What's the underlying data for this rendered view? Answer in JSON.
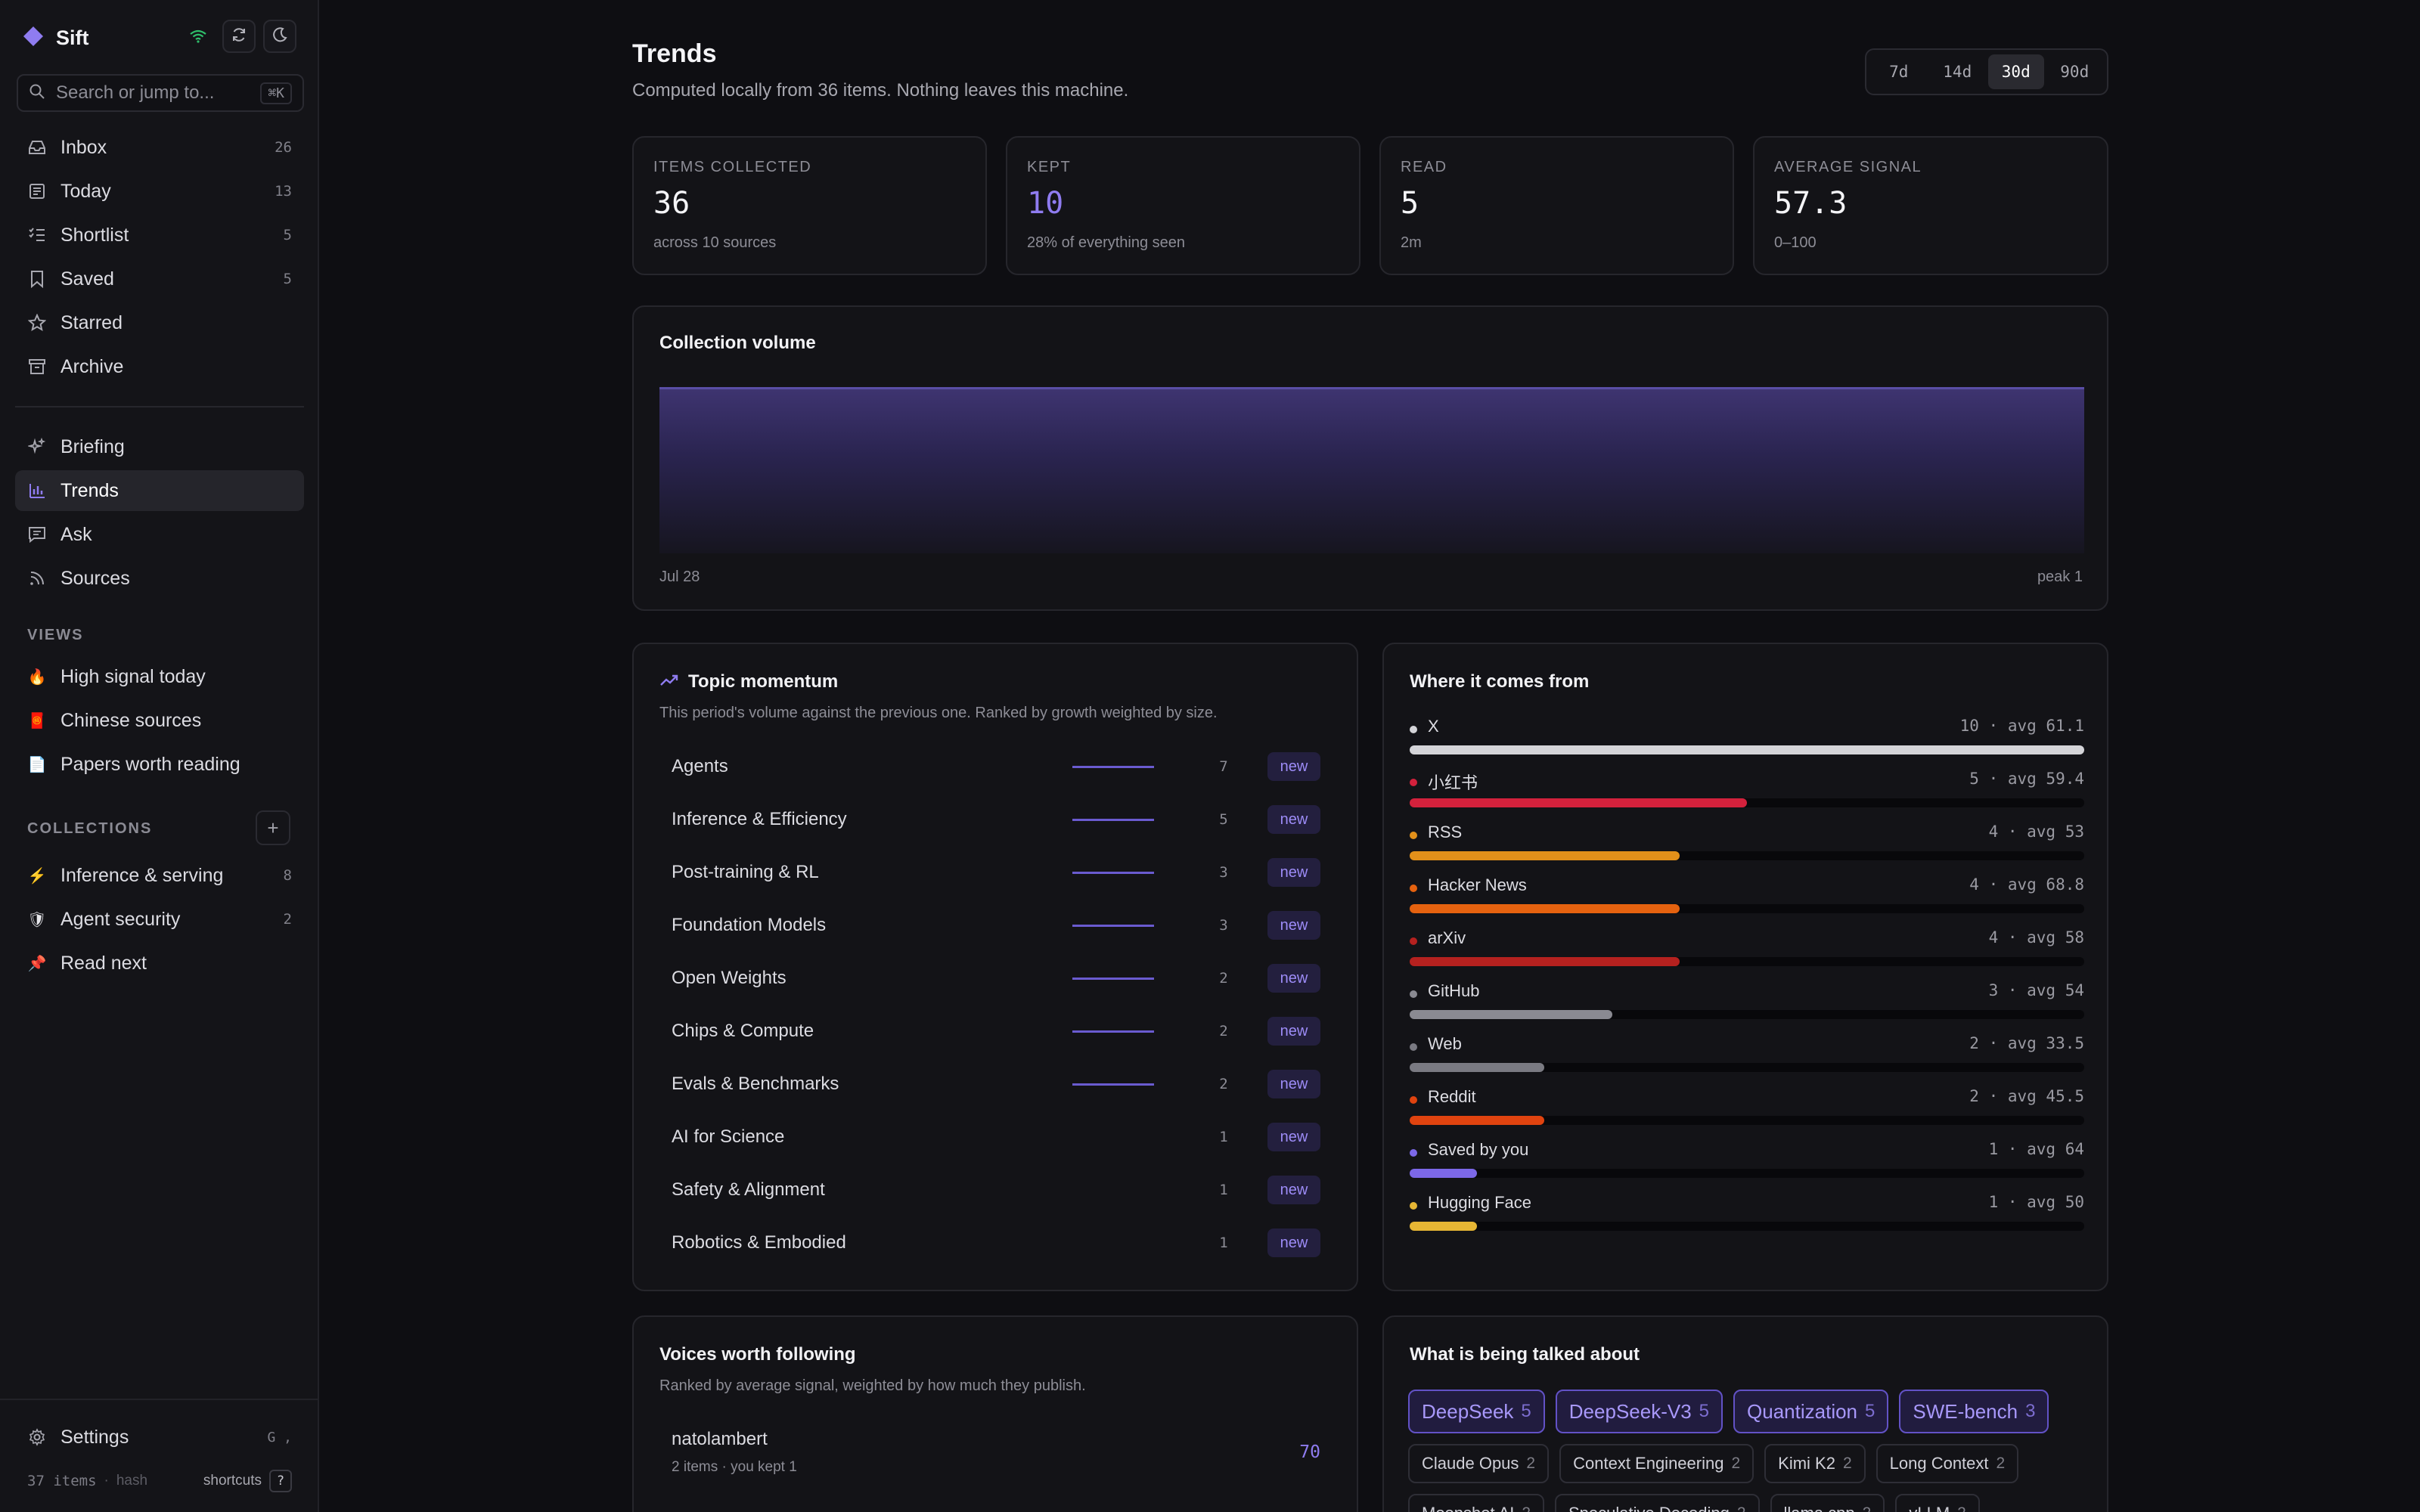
{
  "app": {
    "name": "Sift",
    "search_placeholder": "Search or jump to...",
    "search_shortcut": "⌘K"
  },
  "sidebar": {
    "primary": [
      {
        "label": "Inbox",
        "count": "26"
      },
      {
        "label": "Today",
        "count": "13"
      },
      {
        "label": "Shortlist",
        "count": "5"
      },
      {
        "label": "Saved",
        "count": "5"
      },
      {
        "label": "Starred",
        "count": ""
      },
      {
        "label": "Archive",
        "count": ""
      }
    ],
    "secondary": [
      {
        "label": "Briefing"
      },
      {
        "label": "Trends",
        "active": true
      },
      {
        "label": "Ask"
      },
      {
        "label": "Sources"
      }
    ],
    "views_label": "VIEWS",
    "views": [
      {
        "emoji": "🔥",
        "label": "High signal today"
      },
      {
        "emoji": "🧧",
        "label": "Chinese sources"
      },
      {
        "emoji": "📄",
        "label": "Papers worth reading"
      }
    ],
    "collections_label": "COLLECTIONS",
    "collections": [
      {
        "emoji": "⚡",
        "label": "Inference & serving",
        "count": "8"
      },
      {
        "emoji": "🛡",
        "label": "Agent security",
        "count": "2"
      },
      {
        "emoji": "📌",
        "label": "Read next",
        "count": ""
      }
    ],
    "settings_label": "Settings",
    "settings_key": "G ,",
    "footer_items": "37 items",
    "footer_hash": "hash",
    "footer_shortcuts": "shortcuts",
    "footer_shortcut_key": "?"
  },
  "header": {
    "title": "Trends",
    "subtitle": "Computed locally from 36 items. Nothing leaves this machine.",
    "ranges": [
      "7d",
      "14d",
      "30d",
      "90d"
    ],
    "active_range": "30d"
  },
  "stats": [
    {
      "label": "ITEMS COLLECTED",
      "value": "36",
      "sub": "across 10 sources"
    },
    {
      "label": "KEPT",
      "value": "10",
      "sub": "28% of everything seen"
    },
    {
      "label": "READ",
      "value": "5",
      "sub": "2m"
    },
    {
      "label": "AVERAGE SIGNAL",
      "value": "57.3",
      "sub": "0–100"
    }
  ],
  "volume": {
    "title": "Collection volume",
    "x_label": "Jul 28",
    "peak_label": "peak 1"
  },
  "momentum": {
    "title": "Topic momentum",
    "desc": "This period's volume against the previous one. Ranked by growth weighted by size.",
    "badge": "new",
    "topics": [
      {
        "name": "Agents",
        "count": "7",
        "line": true
      },
      {
        "name": "Inference & Efficiency",
        "count": "5",
        "line": true
      },
      {
        "name": "Post-training & RL",
        "count": "3",
        "line": true
      },
      {
        "name": "Foundation Models",
        "count": "3",
        "line": true
      },
      {
        "name": "Open Weights",
        "count": "2",
        "line": true
      },
      {
        "name": "Chips & Compute",
        "count": "2",
        "line": true
      },
      {
        "name": "Evals & Benchmarks",
        "count": "2",
        "line": true
      },
      {
        "name": "AI for Science",
        "count": "1",
        "line": false
      },
      {
        "name": "Safety & Alignment",
        "count": "1",
        "line": false
      },
      {
        "name": "Robotics & Embodied",
        "count": "1",
        "line": false
      }
    ]
  },
  "sources": {
    "title": "Where it comes from",
    "items": [
      {
        "name": "X",
        "stat": "10 · avg 61.1",
        "share": 1.0,
        "color": "#d4d4d8"
      },
      {
        "name": "小红书",
        "stat": "5 · avg 59.4",
        "share": 0.5,
        "color": "#d3213c"
      },
      {
        "name": "RSS",
        "stat": "4 · avg 53",
        "share": 0.4,
        "color": "#e2901a"
      },
      {
        "name": "Hacker News",
        "stat": "4 · avg 68.8",
        "share": 0.4,
        "color": "#e5620f"
      },
      {
        "name": "arXiv",
        "stat": "4 · avg 58",
        "share": 0.4,
        "color": "#b5211f"
      },
      {
        "name": "GitHub",
        "stat": "3 · avg 54",
        "share": 0.3,
        "color": "#8a8a92"
      },
      {
        "name": "Web",
        "stat": "2 · avg 33.5",
        "share": 0.2,
        "color": "#7a7a82"
      },
      {
        "name": "Reddit",
        "stat": "2 · avg 45.5",
        "share": 0.2,
        "color": "#e0430f"
      },
      {
        "name": "Saved by you",
        "stat": "1 · avg 64",
        "share": 0.1,
        "color": "#7c68e8"
      },
      {
        "name": "Hugging Face",
        "stat": "1 · avg 50",
        "share": 0.1,
        "color": "#e6b634"
      }
    ]
  },
  "voices": {
    "title": "Voices worth following",
    "desc": "Ranked by average signal, weighted by how much they publish.",
    "items": [
      {
        "name": "natolambert",
        "sub": "2 items · you kept 1",
        "score": "70"
      }
    ]
  },
  "talk": {
    "title": "What is being talked about",
    "tags": [
      {
        "label": "DeepSeek",
        "count": "5",
        "hot": true
      },
      {
        "label": "DeepSeek-V3",
        "count": "5",
        "hot": true
      },
      {
        "label": "Quantization",
        "count": "5",
        "hot": true
      },
      {
        "label": "SWE-bench",
        "count": "3",
        "hot": true
      },
      {
        "label": "Claude Opus",
        "count": "2",
        "hot": false
      },
      {
        "label": "Context Engineering",
        "count": "2",
        "hot": false
      },
      {
        "label": "Kimi K2",
        "count": "2",
        "hot": false
      },
      {
        "label": "Long Context",
        "count": "2",
        "hot": false
      },
      {
        "label": "Moonshot AI",
        "count": "2",
        "hot": false
      },
      {
        "label": "Speculative Decoding",
        "count": "2",
        "hot": false
      },
      {
        "label": "llama.cpp",
        "count": "2",
        "hot": false
      },
      {
        "label": "vLLM",
        "count": "2",
        "hot": false
      }
    ]
  },
  "colors": {
    "accent": "#8f7cf0",
    "background": "#0e0e12",
    "sidebar": "#141418",
    "card": "#131317"
  }
}
